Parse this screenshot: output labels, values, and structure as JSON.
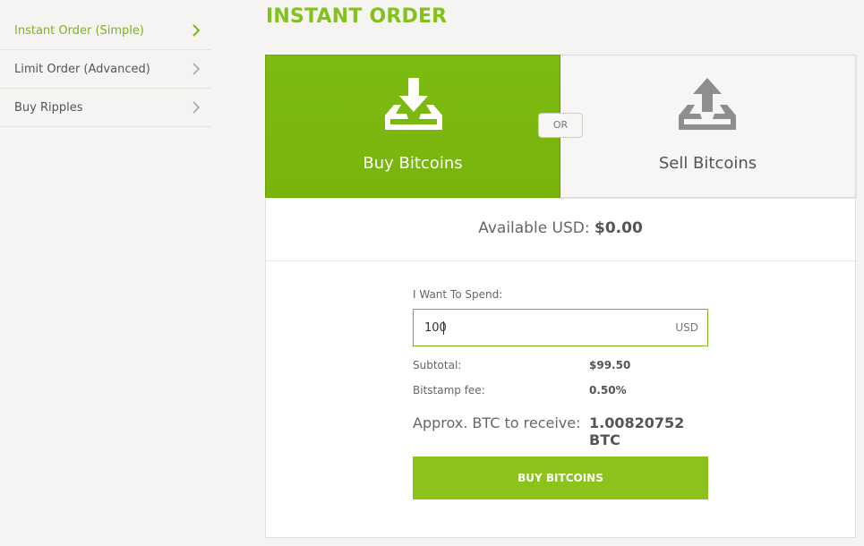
{
  "sidebar": {
    "items": [
      {
        "label": "Instant Order (Simple)",
        "active": true
      },
      {
        "label": "Limit Order (Advanced)",
        "active": false
      },
      {
        "label": "Buy Ripples",
        "active": false
      }
    ]
  },
  "page": {
    "title": "INSTANT ORDER"
  },
  "tabs": {
    "buy": {
      "label": "Buy Bitcoins",
      "icon": "download-tray-icon"
    },
    "sell": {
      "label": "Sell Bitcoins",
      "icon": "upload-tray-icon"
    },
    "or_label": "OR"
  },
  "balance": {
    "label": "Available USD:",
    "value": "$0.00"
  },
  "order_form": {
    "spend_label": "I Want To Spend:",
    "spend_value": "100",
    "spend_unit": "USD",
    "subtotal_label": "Subtotal:",
    "subtotal_value": "$99.50",
    "fee_label": "Bitstamp fee:",
    "fee_value": "0.50%",
    "receive_label": "Approx. BTC to receive:",
    "receive_value": "1.00820752 BTC",
    "submit_label": "BUY BITCOINS"
  },
  "colors": {
    "accent": "#82c21a",
    "buy_tab": "#7ab80e",
    "button": "#8bc21c"
  }
}
